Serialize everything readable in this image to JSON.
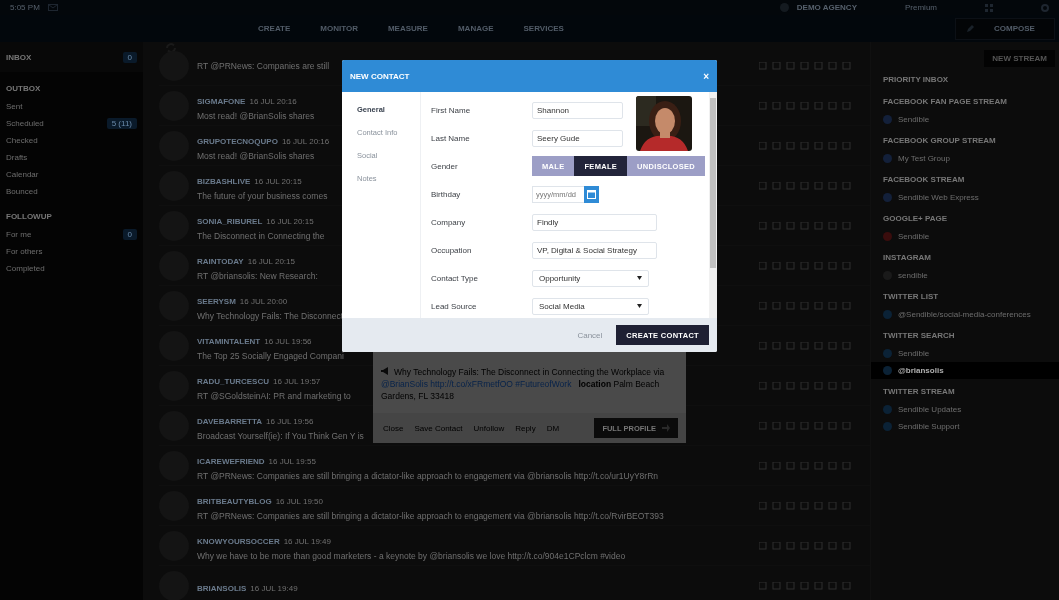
{
  "top_bar": {
    "time": "5:05 PM",
    "account": "DEMO AGENCY",
    "plan": "Premium"
  },
  "nav": {
    "items": [
      "CREATE",
      "MONITOR",
      "MEASURE",
      "MANAGE",
      "SERVICES"
    ],
    "compose": "COMPOSE"
  },
  "sidebar": {
    "inbox": {
      "label": "INBOX",
      "count": "0"
    },
    "sections": [
      {
        "title": "OUTBOX",
        "items": [
          {
            "label": "Sent"
          },
          {
            "label": "Scheduled",
            "count": "5 (11)"
          },
          {
            "label": "Checked"
          },
          {
            "label": "Drafts"
          },
          {
            "label": "Calendar"
          },
          {
            "label": "Bounced"
          }
        ]
      },
      {
        "title": "FOLLOWUP",
        "items": [
          {
            "label": "For me",
            "count": "0"
          },
          {
            "label": "For others"
          },
          {
            "label": "Completed"
          }
        ]
      }
    ]
  },
  "feed": {
    "items": [
      {
        "text": "RT @PRNews: Companies are still"
      },
      {
        "handle": "SIGMAFONE",
        "time": "16 JUL 20:16",
        "text": "Most read! @BrianSolis shares"
      },
      {
        "handle": "GRUPOTECNOQUPO",
        "time": "16 JUL 20:16",
        "text": "Most read! @BrianSolis shares"
      },
      {
        "handle": "BIZBASHLIVE",
        "time": "16 JUL 20:15",
        "text": "The future of your business comes"
      },
      {
        "handle": "SONIA_RIBUREL",
        "time": "16 JUL 20:15",
        "text": "The Disconnect in Connecting the"
      },
      {
        "handle": "RAINTODAY",
        "time": "16 JUL 20:15",
        "text": "RT @briansolis: New Research:"
      },
      {
        "handle": "SEERYSM",
        "time": "16 JUL 20:00",
        "text": "Why Technology Fails: The Disconnect"
      },
      {
        "handle": "VITAMINTALENT",
        "time": "16 JUL 19:56",
        "text": "The Top 25 Socially Engaged Compani"
      },
      {
        "handle": "RADU_TURCESCU",
        "time": "16 JUL 19:57",
        "text": "RT @SGoldsteinAI: PR and marketing to"
      },
      {
        "handle": "DAVEBARRETTA",
        "time": "16 JUL 19:56",
        "text": "Broadcast Yourself(ie): If You Think Gen Y is"
      },
      {
        "handle": "ICAREWEFRIEND",
        "time": "16 JUL 19:55",
        "text": "RT @PRNews: Companies are still bringing a dictator-like approach to engagement via @briansolis http://t.co/ur1UyY8rRn"
      },
      {
        "handle": "BRITBEAUTYBLOG",
        "time": "16 JUL 19:50",
        "text": "RT @PRNews: Companies are still bringing a dictator-like approach to engagement via @briansolis http://t.co/RvirBEOT393"
      },
      {
        "handle": "KNOWYOURSOCCER",
        "time": "16 JUL 19:49",
        "text": "Why we have to be more than good marketers - a keynote by @briansolis we love http://t.co/904e1CPclcm #video"
      },
      {
        "handle": "BRIANSOLIS",
        "time": "16 JUL 19:49"
      }
    ]
  },
  "streams": {
    "new_stream": "NEW STREAM",
    "groups": [
      {
        "title": "PRIORITY INBOX"
      },
      {
        "title": "FACEBOOK FAN PAGE STREAM",
        "items": [
          {
            "label": "Sendible",
            "color": "#13203a",
            "selected": false
          }
        ]
      },
      {
        "title": "FACEBOOK GROUP STREAM",
        "items": [
          {
            "label": "My Test Group",
            "color": "#13203a",
            "selected": false
          }
        ]
      },
      {
        "title": "FACEBOOK STREAM",
        "items": [
          {
            "label": "Sendible Web Express",
            "color": "#13203a",
            "selected": false
          }
        ]
      },
      {
        "title": "GOOGLE+ PAGE",
        "items": [
          {
            "label": "Sendible",
            "color": "#3a0d0d",
            "selected": false
          }
        ]
      },
      {
        "title": "INSTAGRAM",
        "items": [
          {
            "label": "sendible",
            "color": "#1a1a1a",
            "selected": false
          }
        ]
      },
      {
        "title": "TWITTER LIST",
        "items": [
          {
            "label": "@Sendible/social-media-conferences",
            "color": "#0b2236",
            "selected": false
          }
        ]
      },
      {
        "title": "TWITTER SEARCH",
        "items": [
          {
            "label": "Sendible",
            "color": "#0b2236",
            "selected": false
          },
          {
            "label": "@briansolis",
            "color": "#0b2236",
            "selected": true
          }
        ]
      },
      {
        "title": "TWITTER STREAM",
        "items": [
          {
            "label": "Sendible Updates",
            "color": "#0b2236",
            "selected": false
          },
          {
            "label": "Sendible Support",
            "color": "#0b2236",
            "selected": false
          }
        ]
      }
    ]
  },
  "profile_card": {
    "tweet": "Why Technology Fails: The Disconnect in Connecting the Workplace via",
    "links": [
      "@BrianSolis",
      "http://t.co/xFRmetfOO",
      "#FutureofWork"
    ],
    "location_label": "location",
    "location": "Palm Beach Gardens, FL 33418",
    "actions": [
      "Close",
      "Save Contact",
      "Unfollow",
      "Reply",
      "DM"
    ],
    "full_profile": "FULL PROFILE"
  },
  "modal": {
    "title": "NEW CONTACT",
    "close": "×",
    "tabs": [
      {
        "label": "General",
        "selected": true
      },
      {
        "label": "Contact Info",
        "selected": false
      },
      {
        "label": "Social",
        "selected": false
      },
      {
        "label": "Notes",
        "selected": false
      }
    ],
    "fields": [
      {
        "kind": "name",
        "label": "First Name",
        "value": "Shannon"
      },
      {
        "kind": "name",
        "label": "Last Name",
        "value": "Seery Gude"
      },
      {
        "kind": "choice",
        "label": "Gender",
        "options": [
          {
            "label": "MALE",
            "selected": false
          },
          {
            "label": "FEMALE",
            "selected": true
          },
          {
            "label": "UNDISCLOSED",
            "selected": false
          }
        ]
      },
      {
        "kind": "date",
        "label": "Birthday",
        "placeholder": "yyyy/mm/dd"
      },
      {
        "kind": "text",
        "label": "Company",
        "value": "Findly"
      },
      {
        "kind": "text",
        "label": "Occupation",
        "value": "VP, Digital & Social Strategy"
      },
      {
        "kind": "select",
        "label": "Contact Type",
        "value": "Opportunity"
      },
      {
        "kind": "select",
        "label": "Lead Source",
        "value": "Social Media"
      }
    ],
    "cancel": "Cancel",
    "submit": "CREATE CONTACT"
  }
}
